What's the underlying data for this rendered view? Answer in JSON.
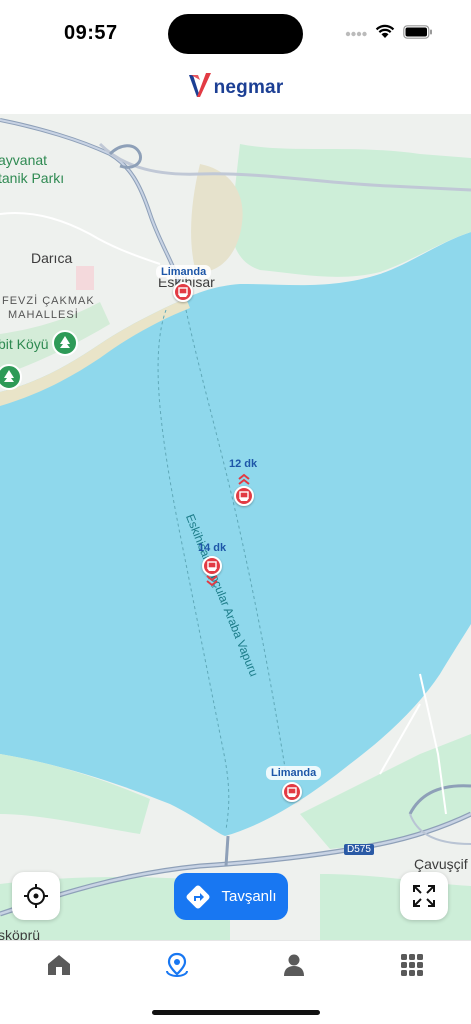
{
  "status_bar": {
    "time": "09:57"
  },
  "header": {
    "logo_text": "negmar",
    "logo_icon": "negmar-logo-icon"
  },
  "map": {
    "places": {
      "darica": "Darıca",
      "hayvanat": "ayvanat",
      "botanik": "tanik Parkı",
      "fevzi": "FEVZİ ÇAKMAK",
      "mahalle": "MAHALLESİ",
      "koyu": "bit Köyü",
      "eskihisar": "Eskihisar",
      "cavusci": "Çavuşçif",
      "koprulu": "sköprü",
      "road": "D575"
    },
    "route_name": "Eskihisar-Topçular Araba Vapuru",
    "piers": {
      "top": "Limanda",
      "bottom": "Limanda"
    },
    "vessels": [
      {
        "eta": "12 dk",
        "direction": "up"
      },
      {
        "eta": "14 dk",
        "direction": "down"
      }
    ],
    "colors": {
      "water": "#8fd8ec",
      "land": "#eef1ee",
      "park": "#cdeed8",
      "marker": "#e23b44"
    }
  },
  "controls": {
    "locate_icon": "crosshair-icon",
    "expand_icon": "expand-icon",
    "destination_label": "Tavşanlı",
    "destination_icon": "directions-icon"
  },
  "tabs": [
    {
      "icon": "home-icon",
      "active": false
    },
    {
      "icon": "map-pin-icon",
      "active": true
    },
    {
      "icon": "user-icon",
      "active": false
    },
    {
      "icon": "grid-icon",
      "active": false
    }
  ]
}
